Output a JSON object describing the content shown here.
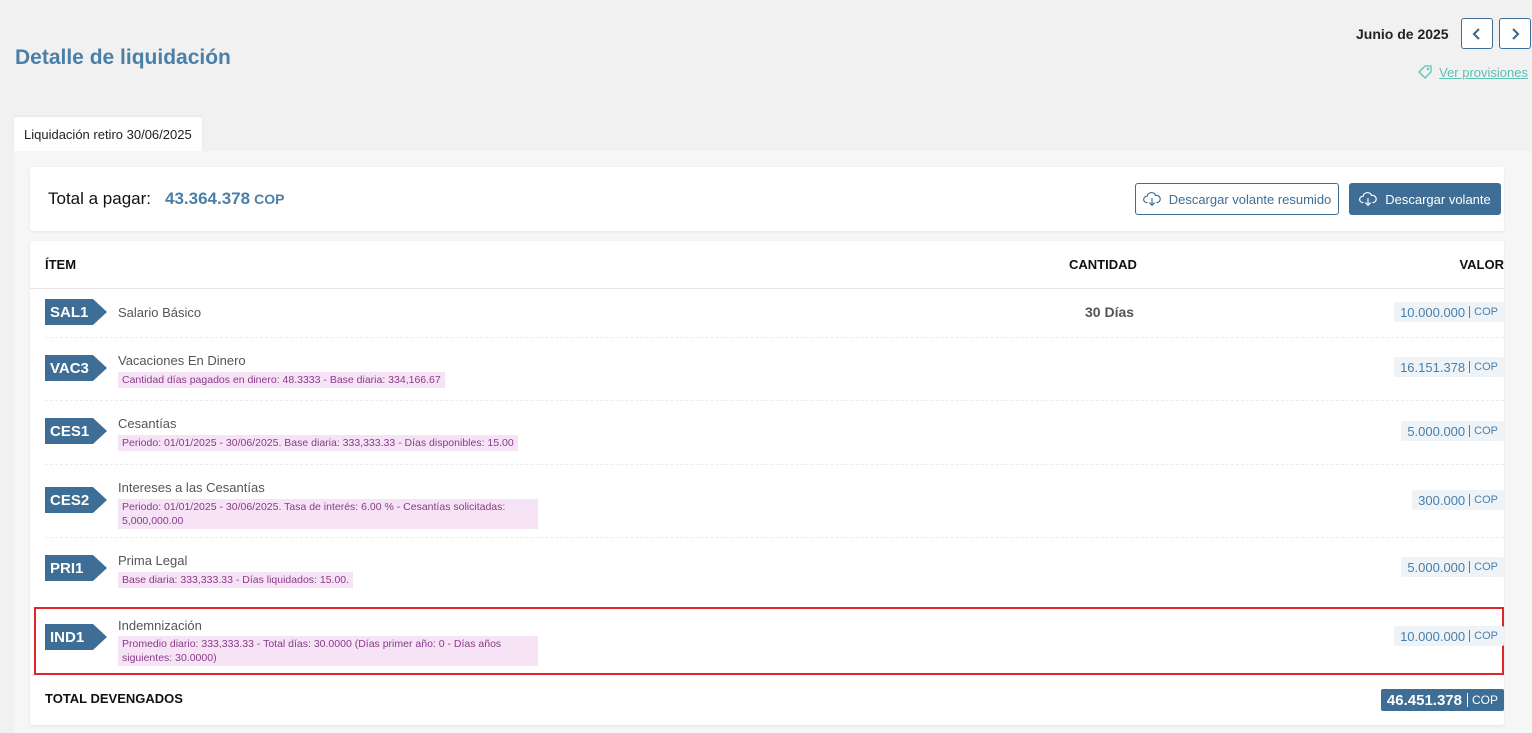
{
  "header": {
    "title": "Detalle de liquidación",
    "period": "Junio de 2025",
    "provisions_link": "Ver provisiones"
  },
  "tab": {
    "label": "Liquidación retiro 30/06/2025"
  },
  "summary": {
    "total_label": "Total a pagar:",
    "total_value": "43.364.378",
    "currency": "COP",
    "download_summary_label": "Descargar volante resumido",
    "download_label": "Descargar volante"
  },
  "table": {
    "columns": {
      "item": "ÍTEM",
      "quantity": "CANTIDAD",
      "value": "VALOR"
    },
    "rows": [
      {
        "code": "SAL1",
        "description": "Salario Básico",
        "note": "",
        "quantity": "30  Días",
        "value": "10.000.000",
        "currency": "COP"
      },
      {
        "code": "VAC3",
        "description": "Vacaciones En Dinero",
        "note": "Cantidad días pagados en dinero: 48.3333 - Base diaria: 334,166.67",
        "quantity": "",
        "value": "16.151.378",
        "currency": "COP"
      },
      {
        "code": "CES1",
        "description": "Cesantías",
        "note": "Periodo: 01/01/2025 - 30/06/2025. Base diaria: 333,333.33 - Días disponibles: 15.00",
        "quantity": "",
        "value": "5.000.000",
        "currency": "COP"
      },
      {
        "code": "CES2",
        "description": "Intereses a las Cesantías",
        "note": "Periodo: 01/01/2025 - 30/06/2025. Tasa de interés: 6.00 % - Cesantías solicitadas: 5,000,000.00",
        "quantity": "",
        "value": "300.000",
        "currency": "COP"
      },
      {
        "code": "PRI1",
        "description": "Prima Legal",
        "note": "Base diaria: 333,333.33 - Días liquidados: 15.00.",
        "quantity": "",
        "value": "5.000.000",
        "currency": "COP"
      },
      {
        "code": "IND1",
        "description": "Indemnización",
        "note": "Promedio diario: 333,333.33 - Total días: 30.0000 (Días primer año: 0 - Días años siguientes: 30.0000)",
        "quantity": "",
        "value": "10.000.000",
        "currency": "COP"
      }
    ],
    "total_label": "TOTAL DEVENGADOS",
    "total_value": "46.451.378",
    "total_currency": "COP"
  },
  "colors": {
    "primary": "#3e6e96",
    "title": "#4a7fa8",
    "link": "#5fbfb2",
    "note_bg": "#f6e4f6",
    "note_text": "#8a3a8a",
    "highlight": "#e0262b"
  },
  "icons": {
    "prev": "chevron-left-icon",
    "next": "chevron-right-icon",
    "provisions": "tag-icon",
    "download": "cloud-download-icon"
  }
}
